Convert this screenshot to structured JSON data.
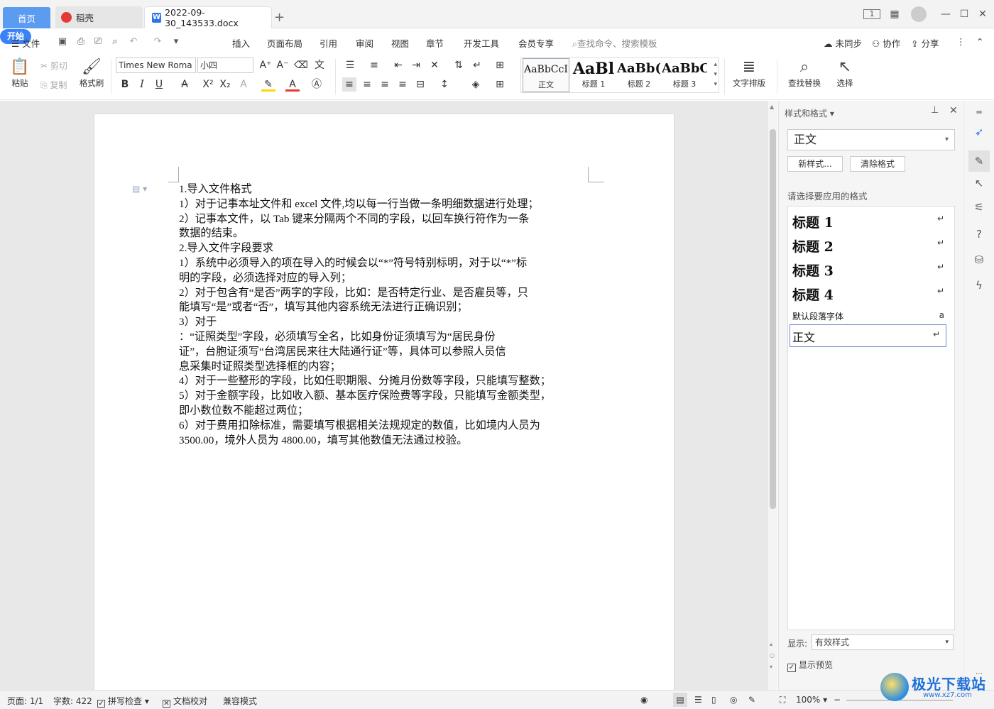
{
  "titlebar": {
    "tabs": [
      {
        "label": "首页"
      },
      {
        "label": "稻壳"
      },
      {
        "label": "2022-09-30_143533.docx"
      }
    ],
    "add_tab": "+"
  },
  "menubar": {
    "file": "文件",
    "items": [
      "开始",
      "插入",
      "页面布局",
      "引用",
      "审阅",
      "视图",
      "章节",
      "开发工具",
      "会员专享"
    ],
    "search_placeholder": "查找命令、搜索模板",
    "right": {
      "sync": "未同步",
      "collab": "协作",
      "share": "分享"
    }
  },
  "ribbon": {
    "paste": "粘贴",
    "cut": "剪切",
    "copy": "复制",
    "format_painter": "格式刷",
    "font_name": "Times New Roma",
    "font_size": "小四",
    "styles": [
      {
        "preview": "AaBbCcI",
        "label": "正文"
      },
      {
        "preview": "AaBl",
        "label": "标题 1"
      },
      {
        "preview": "AaBb(",
        "label": "标题 2"
      },
      {
        "preview": "AaBbC",
        "label": "标题 3"
      }
    ],
    "text_layout": "文字排版",
    "find_replace": "查找替换",
    "select": "选择"
  },
  "document": {
    "lines": [
      "1.导入文件格式",
      "1）对于记事本址文件和 excel 文件,均以每一行当做一条明细数据进行处理；",
      "2）记事本文件，以 Tab 键来分隔两个不同的字段，以回车换行符作为一条",
      "数据的结束。",
      "2.导入文件字段要求",
      "1）系统中必须导入的项在导入的时候会以“*”符号特别标明，对于以“*”标",
      "明的字段，必须选择对应的导入列；",
      "2）对于包含有“是否”两字的字段，比如：是否特定行业、是否雇员等，只",
      "能填写“是”或者“否”，填写其他内容系统无法进行正确识别；",
      "3）对于",
      "：“证照类型”字段，必须填写全名，比如身份证须填写为“居民身份",
      "证”，台胞证须写“台湾居民来往大陆通行证”等，具体可以参照人员信",
      "息采集时证照类型选择框的内容；",
      "4）对于一些整形的字段，比如任职期限、分摊月份数等字段，只能填写整数；",
      "5）对于金额字段，比如收入额、基本医疗保险费等字段，只能填写金额类型，",
      "即小数位数不能超过两位；",
      "6）对于费用扣除标准，需要填写根据相关法规规定的数值，比如境内人员为",
      "3500.00，境外人员为 4800.00，填写其他数值无法通过校验。"
    ]
  },
  "panel": {
    "title": "样式和格式",
    "current_style": "正文",
    "new_style": "新样式...",
    "clear_format": "清除格式",
    "prompt": "请选择要应用的格式",
    "styles": [
      {
        "name": "标题 1",
        "mark": "↵"
      },
      {
        "name": "标题 2",
        "mark": "↵"
      },
      {
        "name": "标题 3",
        "mark": "↵"
      },
      {
        "name": "标题 4",
        "mark": "↵"
      },
      {
        "name": "默认段落字体",
        "mark": "a"
      },
      {
        "name": "正文",
        "mark": "↵"
      }
    ],
    "show_label": "显示:",
    "show_value": "有效样式",
    "preview_label": "显示预览"
  },
  "statusbar": {
    "page": "页面: 1/1",
    "words": "字数: 422",
    "spell": "拼写检查",
    "proof": "文档校对",
    "compat": "兼容模式",
    "zoom": "100%"
  },
  "watermark": {
    "text": "极光下载站",
    "sub": "www.xz7.com"
  }
}
